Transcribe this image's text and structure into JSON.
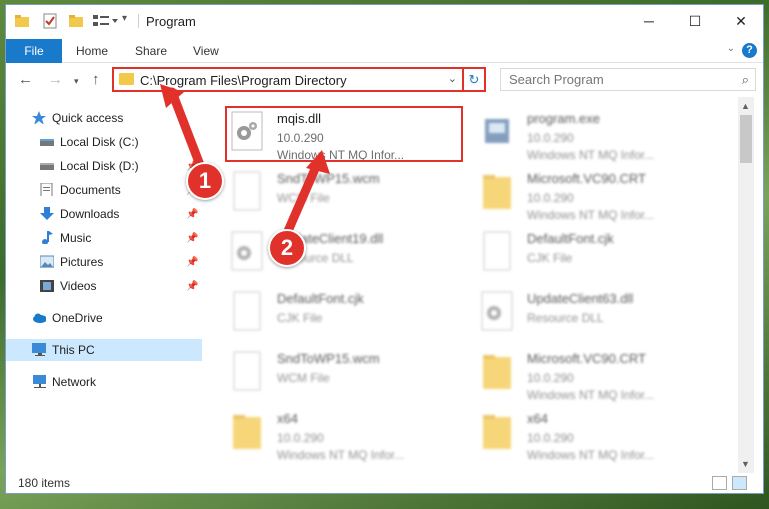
{
  "window": {
    "title": "Program",
    "controls": {
      "minimize": "─",
      "maximize": "☐",
      "close": "✕"
    }
  },
  "ribbon": {
    "tabs": [
      "File",
      "Home",
      "Share",
      "View"
    ],
    "help": "?"
  },
  "nav": {
    "address": "C:\\Program Files\\Program Directory",
    "search_placeholder": "Search Program"
  },
  "sidebar": {
    "items": [
      {
        "label": "Quick access",
        "icon": "star-icon",
        "pinned": false
      },
      {
        "label": "Local Disk (C:)",
        "icon": "drive-icon",
        "pinned": false
      },
      {
        "label": "Local Disk (D:)",
        "icon": "drive-icon",
        "pinned": true
      },
      {
        "label": "Documents",
        "icon": "documents-icon",
        "pinned": true
      },
      {
        "label": "Downloads",
        "icon": "download-icon",
        "pinned": true
      },
      {
        "label": "Music",
        "icon": "music-icon",
        "pinned": true
      },
      {
        "label": "Pictures",
        "icon": "pictures-icon",
        "pinned": true
      },
      {
        "label": "Videos",
        "icon": "videos-icon",
        "pinned": true
      },
      {
        "label": "OneDrive",
        "icon": "cloud-icon",
        "pinned": false
      },
      {
        "label": "This PC",
        "icon": "computer-icon",
        "pinned": false
      },
      {
        "label": "Network",
        "icon": "network-icon",
        "pinned": false
      }
    ]
  },
  "files": [
    {
      "name": "mqis.dll",
      "line1": "10.0.290",
      "line2": "Windows NT MQ Infor...",
      "icon": "dll-gear-icon"
    },
    {
      "name": "program.exe",
      "line1": "10.0.290",
      "line2": "Windows NT MQ Infor...",
      "icon": "exe-icon"
    },
    {
      "name": "SndToWP15.wcm",
      "line1": "WCM File",
      "line2": "",
      "icon": "file-icon"
    },
    {
      "name": "Microsoft.VC90.CRT",
      "line1": "10.0.290",
      "line2": "Windows NT MQ Infor...",
      "icon": "folder-icon"
    },
    {
      "name": "UpdateClient19.dll",
      "line1": "Resource DLL",
      "line2": "",
      "icon": "dll-gear-icon"
    },
    {
      "name": "DefaultFont.cjk",
      "line1": "CJK File",
      "line2": "",
      "icon": "file-icon"
    },
    {
      "name": "DefaultFont.cjk",
      "line1": "CJK File",
      "line2": "",
      "icon": "file-icon"
    },
    {
      "name": "UpdateClient63.dll",
      "line1": "Resource DLL",
      "line2": "",
      "icon": "dll-gear-icon"
    },
    {
      "name": "SndToWP15.wcm",
      "line1": "WCM File",
      "line2": "",
      "icon": "file-icon"
    },
    {
      "name": "Microsoft.VC90.CRT",
      "line1": "10.0.290",
      "line2": "Windows NT MQ Infor...",
      "icon": "folder-icon"
    },
    {
      "name": "x64",
      "line1": "10.0.290",
      "line2": "Windows NT MQ Infor...",
      "icon": "folder-icon"
    },
    {
      "name": "x64",
      "line1": "10.0.290",
      "line2": "Windows NT MQ Infor...",
      "icon": "folder-icon"
    }
  ],
  "status": {
    "count": "180 items"
  },
  "callouts": [
    "1",
    "2"
  ],
  "colors": {
    "accent": "#1979ca",
    "highlight": "#e0312b",
    "selected": "#cce8ff"
  }
}
